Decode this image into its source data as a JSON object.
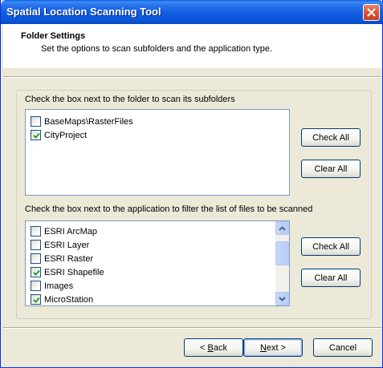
{
  "window": {
    "title": "Spatial Location Scanning Tool"
  },
  "header": {
    "title": "Folder Settings",
    "subtitle": "Set the options to scan subfolders and the application type."
  },
  "folders": {
    "instruction": "Check the box next to the folder to scan its subfolders",
    "items": [
      {
        "label": "BaseMaps\\RasterFiles",
        "checked": false
      },
      {
        "label": "CityProject",
        "checked": true
      }
    ],
    "check_all_label": "Check All",
    "clear_all_label": "Clear All"
  },
  "applications": {
    "instruction": "Check the box next to the application to filter the list of files to be scanned",
    "items": [
      {
        "label": "ESRI ArcMap",
        "checked": false
      },
      {
        "label": "ESRI Layer",
        "checked": false
      },
      {
        "label": "ESRI Raster",
        "checked": false
      },
      {
        "label": "ESRI Shapefile",
        "checked": true
      },
      {
        "label": "Images",
        "checked": false
      },
      {
        "label": "MicroStation",
        "checked": true
      }
    ],
    "check_all_label": "Check All",
    "clear_all_label": "Clear All"
  },
  "footer": {
    "back_prefix": "< ",
    "back_mnemonic": "B",
    "back_rest": "ack",
    "next_mnemonic": "N",
    "next_rest": "ext >",
    "cancel_label": "Cancel"
  },
  "colors": {
    "titlebar": "#0a54d8",
    "dialog_bg": "#ece9d8",
    "close_button": "#d8583a"
  }
}
